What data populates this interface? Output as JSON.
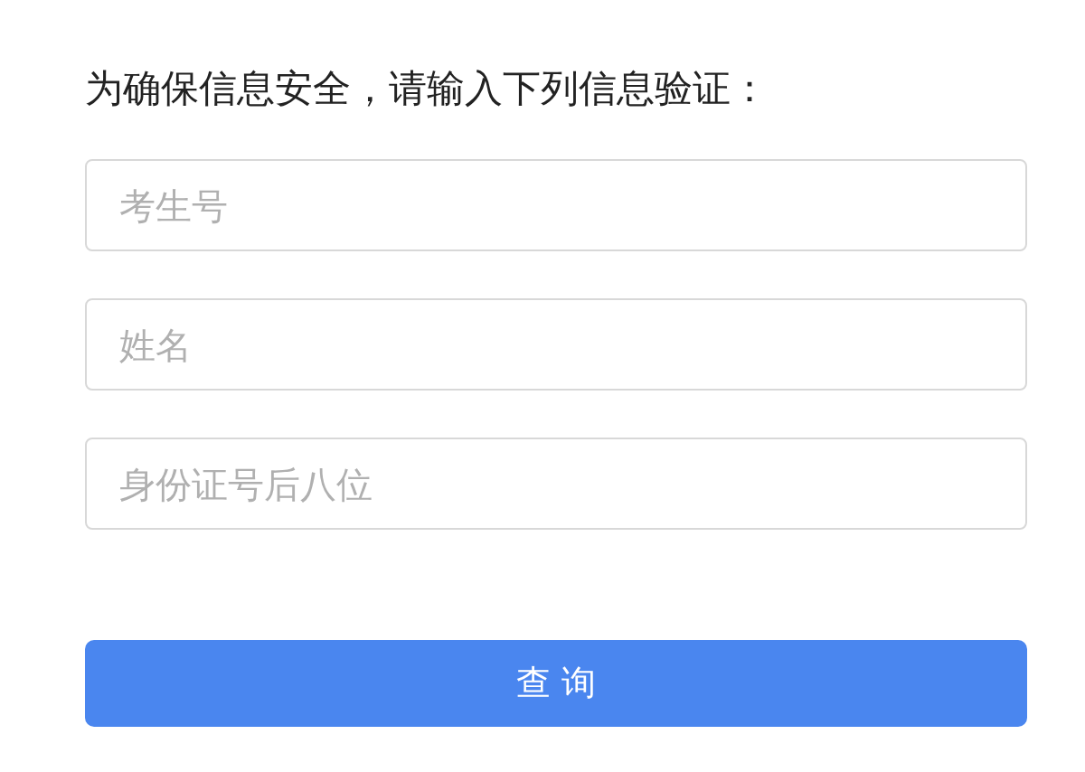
{
  "prompt": "为确保信息安全，请输入下列信息验证：",
  "fields": [
    {
      "placeholder": "考生号"
    },
    {
      "placeholder": "姓名"
    },
    {
      "placeholder": "身份证号后八位"
    }
  ],
  "button": "查 询"
}
